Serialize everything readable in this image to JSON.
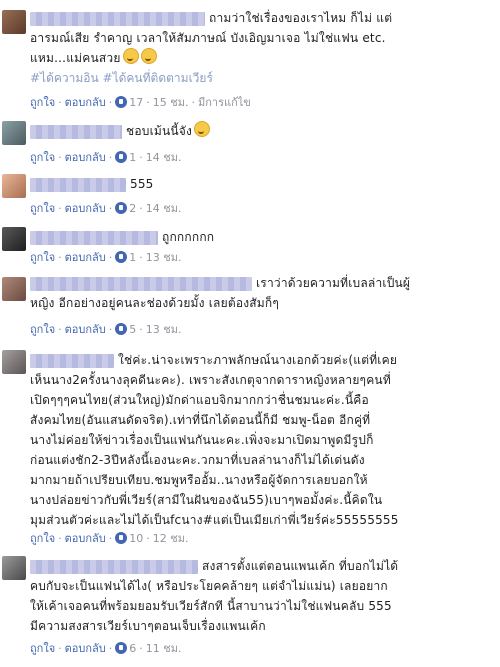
{
  "ui": {
    "like": "ถูกใจ",
    "reply": "ตอบกลับ",
    "sep": "·"
  },
  "comments": [
    {
      "lines": [
        "ถามว่าใช่เรื่องของเราไหม ก็ไม่ แต่",
        "อารมณ์เสีย รำคาญ เวลาให้สัมภาษณ์ บังเอิญมาเจอ ไม่ใช่แฟน etc.",
        "แหม...แม่คนสวย"
      ],
      "tags": "#ได้ความอิน #ได้คนที่ติดตามเวียร์",
      "likes": "17",
      "time": "15 ชม.",
      "edited": "มีการแก้ไข"
    },
    {
      "lines": [
        "ชอบเม้นนี้จัง"
      ],
      "likes": "1",
      "time": "14 ชม."
    },
    {
      "lines": [
        "555"
      ],
      "likes": "2",
      "time": "14 ชม."
    },
    {
      "lines": [
        "ถูกกกกกก"
      ],
      "likes": "1",
      "time": "13 ชม."
    },
    {
      "lines": [
        "เราว่าด้วยความที่เบลล่าเป็นผู้",
        "หญิง อีกอย่างอยู่คนละช่องด้วยมั้ง เลยต้องสัมก็ๆ"
      ],
      "likes": "5",
      "time": "13 ชม."
    },
    {
      "lines": [
        "ใช่ค่ะ.น่าจะเพราะภาพลักษณ์นางเอกด้วยค่ะ(แต่ที่เคย",
        "เห็นนาง2ครั้งนางลุคดีนะคะ). เพราะสังเกตุจากดาราหญิงหลายๆคนที่",
        "เปิดๆๆๆคนไทย(ส่วนใหญ่)มักด่าแอบจิกมากกว่าชื่นชมนะค่ะ.นี้คือ",
        "สังคมไทย(อันแสนดัดจริต).เท่าที่นึกได้ตอนนี้ก็มี ชมพู-น็อต อีกคู่ที่",
        "นางไม่ค่อยให้ข่าวเรื่องเป็นแฟนกันนะคะ.เพิ่งจะมาเปิดมาพูดมีรูปก็",
        "ก่อนแต่งชัก2-3ปีหลังนี้เองนะคะ.วกมาที่เบลล่านางก็ไม่ได้เด่นดัง",
        "มากมายถ้าเปรียบเทียบ.ชมพูหรืออั้ม..นางหรือผู้จัดการเลยบอกให้",
        "นางปล่อยข่าวกับพี่เวียร์(สามีในฝันของฉัน55)เบาๆพอมั้งค่ะ.นี้คิดใน",
        "มุมส่วนตัวค่ะและไม่ได้เป็นfcนาง#แต่เป็นเมียเก่าพี่เวียร์ค่ะ55555555"
      ],
      "likes": "10",
      "time": "12 ชม."
    },
    {
      "lines": [
        "สงสารตั้งแต่ตอนแพนเค้ก ที่บอกไม่ได้",
        "คบกับจะเป็นแฟนได้ไง( หรือประโยคคล้ายๆ แต่จำไม่แม่น) เลยอยาก",
        "ให้เค้าเจอคนที่พร้อมยอมรับเวียร์สักที นี้สาบานว่าไม่ใช่แฟนคลับ 555",
        "มีความสงสารเวียร์เบาๆตอนเจ็บเรื่องแพนเค้ก"
      ],
      "likes": "6",
      "time": "11 ชม."
    }
  ]
}
